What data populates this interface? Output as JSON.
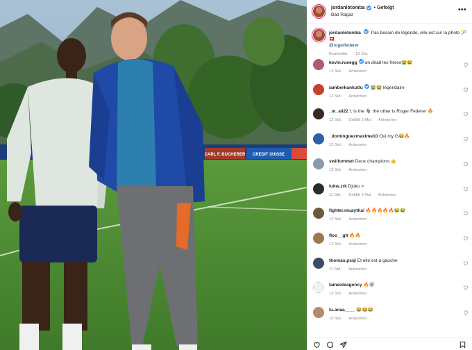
{
  "header": {
    "username": "jordanlotomba",
    "follow_status": "Gefolgt",
    "dot": "•",
    "location": "Bad Ragaz",
    "more_icon": "more-horizontal-icon"
  },
  "caption": {
    "username": "jordanlotomba",
    "text": "Pas besoin de légende, elle est sur la photo 🎾🇨🇭",
    "mention": "@rogerfederer",
    "edited": "Bearbeitet",
    "time": "13 Std."
  },
  "labels": {
    "reply": "Antworten"
  },
  "comments": [
    {
      "user": "kevin.rueegg",
      "verified": true,
      "text": "on dirait les frères😭😂",
      "time": "12 Std.",
      "likes": "",
      "avatar_color": "#b25a6e"
    },
    {
      "user": "iamberkankutlu",
      "verified": true,
      "text": "😭😭 légendaire",
      "time": "12 Std.",
      "likes": "",
      "avatar_color": "#c6402f"
    },
    {
      "user": "_m_ali22",
      "verified": false,
      "text": "1 is the 🐐 the other is Roger Federer 🔥",
      "time": "12 Std.",
      "likes": "Gefällt 2 Mal",
      "avatar_color": "#3a2a22"
    },
    {
      "user": "_dominguezmaxime10",
      "verified": false,
      "text": "Oui my G😂🔥",
      "time": "12 Std.",
      "likes": "",
      "avatar_color": "#2f5fa6"
    },
    {
      "user": "swillommet",
      "verified": false,
      "text": "Deux champions 👍",
      "time": "12 Std.",
      "likes": "",
      "avatar_color": "#8a9aa8"
    },
    {
      "user": "lukw.zrk",
      "verified": false,
      "text": "Djoko >",
      "time": "11 Std.",
      "likes": "Gefällt 1 Mal",
      "avatar_color": "#2b2b2b"
    },
    {
      "user": "fighter.muaythai",
      "verified": false,
      "text": "🔥🔥🔥🔥🔥😂😂",
      "time": "12 Std.",
      "likes": "",
      "avatar_color": "#6b5a3a"
    },
    {
      "user": "floo__glt",
      "verified": false,
      "text": "🔥🔥",
      "time": "12 Std.",
      "likes": "",
      "avatar_color": "#9c7a4e"
    },
    {
      "user": "thomas.psql",
      "verified": false,
      "text": "Et elle est a gauche",
      "time": "11 Std.",
      "likes": "",
      "avatar_color": "#3d4c66"
    },
    {
      "user": "lameuteagency",
      "verified": false,
      "text": "🔥🐺",
      "time": "13 Std.",
      "likes": "",
      "avatar_color": "#f2f2f2"
    },
    {
      "user": "lu.anaa____",
      "verified": false,
      "text": "😂😂😂",
      "time": "10 Std.",
      "likes": "",
      "avatar_color": "#b58a6a"
    }
  ],
  "footer_icons": [
    "heart-icon",
    "comment-icon",
    "share-icon",
    "bookmark-icon"
  ],
  "photo": {
    "ad_board_1": "CARL F. BUCHERER",
    "ad_board_2": "CREDIT SUISSE",
    "colors": {
      "sky": "#8fb0c8",
      "mountain": "#5e7a6a",
      "grass": "#5f9d3c",
      "jacket": "#1f4aa8"
    }
  }
}
